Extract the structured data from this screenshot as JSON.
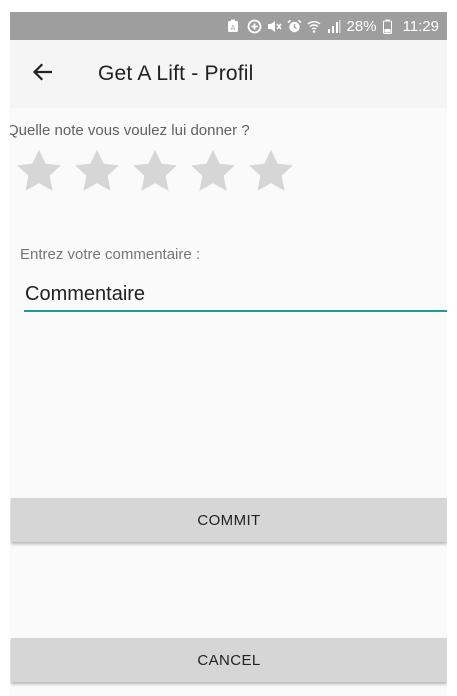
{
  "status_bar": {
    "battery_percent": "28%",
    "time": "11:29",
    "icons": [
      "battery-saver-icon",
      "data-saver-icon",
      "mute-icon",
      "alarm-icon",
      "wifi-icon",
      "signal-icon",
      "battery-icon"
    ]
  },
  "app_bar": {
    "back_icon": "arrow-left-icon",
    "title": "Get A Lift - Profil"
  },
  "rating": {
    "label": "Quelle note vous voulez lui donner ?",
    "max_stars": 5,
    "value": 0,
    "empty_star_color": "#d6d6d6"
  },
  "comment": {
    "label": "Entrez votre commentaire :",
    "placeholder": "Commentaire",
    "value": "",
    "underline_color": "#1e9e96"
  },
  "buttons": {
    "commit_label": "COMMIT",
    "cancel_label": "CANCEL"
  }
}
